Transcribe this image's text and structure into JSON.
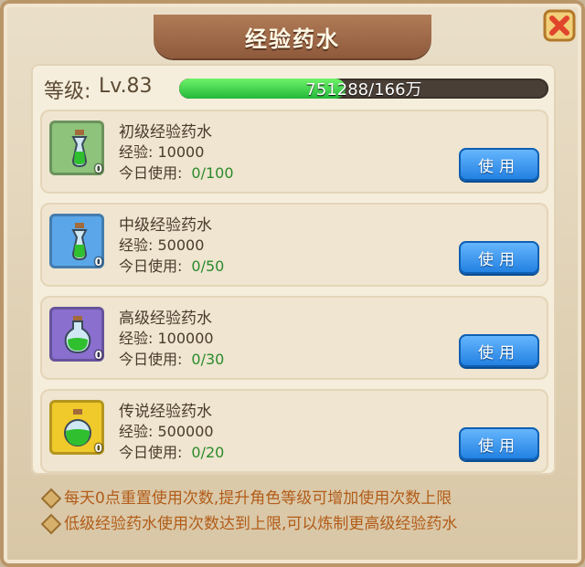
{
  "title": "经验药水",
  "level": {
    "label": "等级:",
    "value": "Lv.83"
  },
  "progress": {
    "text": "751288/166万",
    "fraction": 0.45
  },
  "items": [
    {
      "name": "初级经验药水",
      "exp": "经验: 10000",
      "use_label": "今日使用:",
      "use_count": "0/100",
      "count": "0",
      "button": "使用",
      "bg": "#8ec37b",
      "potion": "#2fbf2f"
    },
    {
      "name": "中级经验药水",
      "exp": "经验: 50000",
      "use_label": "今日使用:",
      "use_count": "0/50",
      "count": "0",
      "button": "使用",
      "bg": "#5aa6e8",
      "potion": "#2fbf2f"
    },
    {
      "name": "高级经验药水",
      "exp": "经验: 100000",
      "use_label": "今日使用:",
      "use_count": "0/30",
      "count": "0",
      "button": "使用",
      "bg": "#8a6fcf",
      "potion": "#2fbf2f"
    },
    {
      "name": "传说经验药水",
      "exp": "经验: 500000",
      "use_label": "今日使用:",
      "use_count": "0/20",
      "count": "0",
      "button": "使用",
      "bg": "#f0c92a",
      "potion": "#2fbf2f"
    }
  ],
  "notes": [
    "每天0点重置使用次数,提升角色等级可增加使用次数上限",
    "低级经验药水使用次数达到上限,可以炼制更高级经验药水"
  ]
}
